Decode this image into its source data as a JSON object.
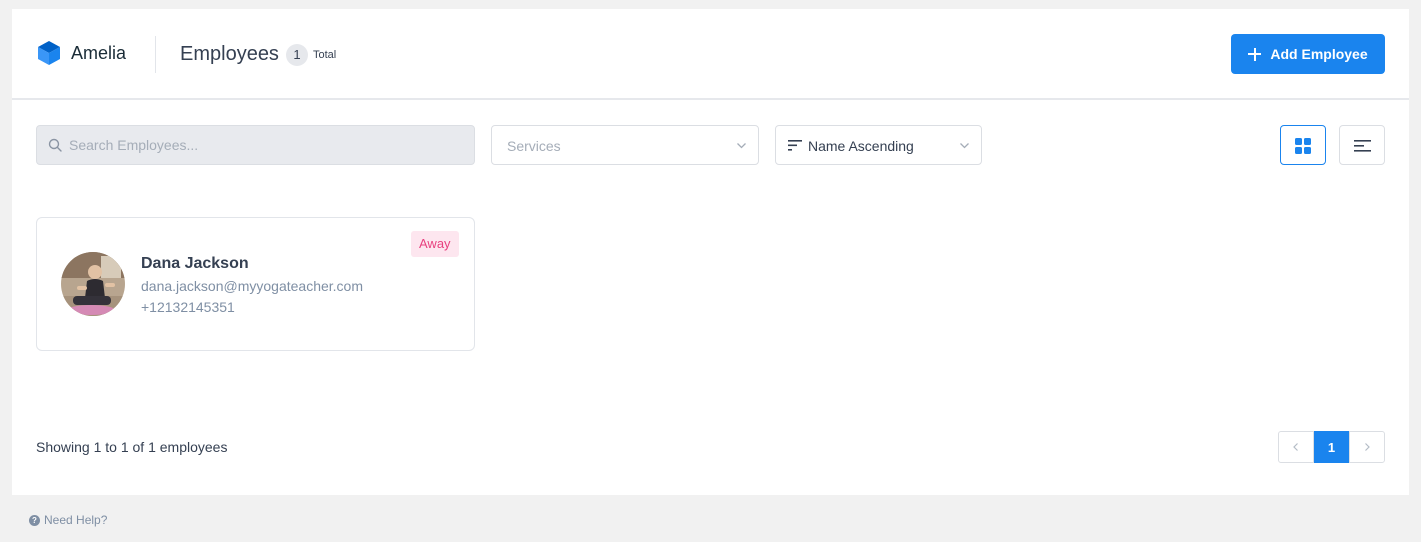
{
  "app": {
    "brand": "Amelia"
  },
  "header": {
    "title": "Employees",
    "count": "1",
    "count_label": "Total",
    "add_button_label": "Add Employee"
  },
  "filters": {
    "search_placeholder": "Search Employees...",
    "services_placeholder": "Services",
    "sort_value": "Name Ascending"
  },
  "employees": [
    {
      "name": "Dana Jackson",
      "email": "dana.jackson@myyogateacher.com",
      "phone": "+12132145351",
      "status": "Away"
    }
  ],
  "footer": {
    "showing": "Showing 1 to 1 of 1 employees",
    "current_page": "1"
  },
  "help": {
    "label": "Need Help?"
  },
  "colors": {
    "accent": "#1a84ee",
    "status_away_bg": "#fde6ef",
    "status_away_text": "#e8417f"
  },
  "icons": [
    "amelia-logo-icon",
    "plus-icon",
    "search-icon",
    "chevron-down-icon",
    "sort-icon",
    "grid-view-icon",
    "list-view-icon",
    "chevron-left-icon",
    "chevron-right-icon",
    "help-icon"
  ]
}
